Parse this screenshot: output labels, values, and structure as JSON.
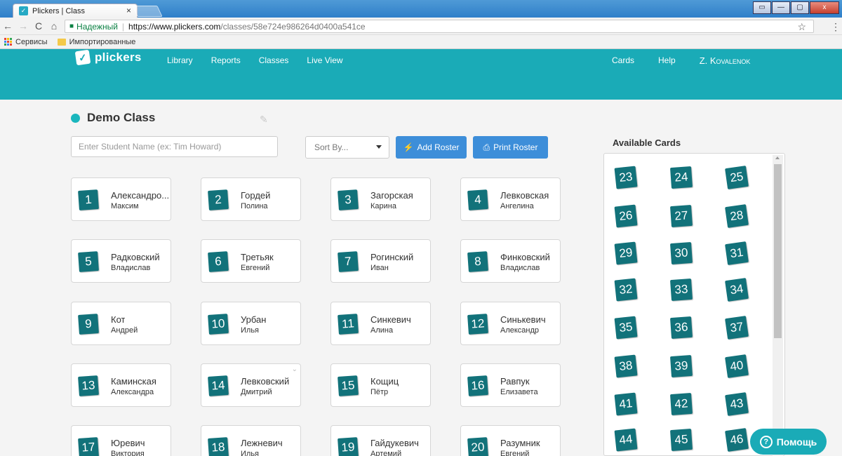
{
  "browser": {
    "tab_title": "Plickers | Class",
    "tab_close": "×",
    "secure_label": "Надежный",
    "url_host": "https://www.plickers.com",
    "url_path": "/classes/58e724e986264d0400a541ce",
    "bookmarks": [
      "Сервисы",
      "Импортированные"
    ],
    "window_controls": [
      "▭",
      "—",
      "▢",
      "x"
    ]
  },
  "app": {
    "logo": "plickers",
    "nav_left": [
      "Library",
      "Reports",
      "Classes",
      "Live View"
    ],
    "nav_right": [
      "Cards",
      "Help"
    ],
    "user": "Z. Kovalenok",
    "accent_color": "#1aabb7"
  },
  "class": {
    "name": "Demo Class",
    "search_placeholder": "Enter Student Name (ex: Tim Howard)",
    "sort_label": "Sort By...",
    "add_roster": "Add Roster",
    "print_roster": "Print Roster"
  },
  "students": [
    {
      "num": "1",
      "last": "Александро...",
      "first": "Максим"
    },
    {
      "num": "2",
      "last": "Гордей",
      "first": "Полина"
    },
    {
      "num": "3",
      "last": "Загорская",
      "first": "Карина"
    },
    {
      "num": "4",
      "last": "Левковская",
      "first": "Ангелина"
    },
    {
      "num": "5",
      "last": "Радковский",
      "first": "Владислав"
    },
    {
      "num": "6",
      "last": "Третьяк",
      "first": "Евгений"
    },
    {
      "num": "7",
      "last": "Рогинский",
      "first": "Иван"
    },
    {
      "num": "8",
      "last": "Финковский",
      "first": "Владислав"
    },
    {
      "num": "9",
      "last": "Кот",
      "first": "Андрей"
    },
    {
      "num": "10",
      "last": "Урбан",
      "first": "Илья"
    },
    {
      "num": "11",
      "last": "Синкевич",
      "first": "Алина"
    },
    {
      "num": "12",
      "last": "Синькевич",
      "first": "Александр"
    },
    {
      "num": "13",
      "last": "Каминская",
      "first": "Александра"
    },
    {
      "num": "14",
      "last": "Левковский",
      "first": "Дмитрий"
    },
    {
      "num": "15",
      "last": "Кощиц",
      "first": "Пётр"
    },
    {
      "num": "16",
      "last": "Равпук",
      "first": "Елизавета"
    },
    {
      "num": "17",
      "last": "Юревич",
      "first": "Виктория"
    },
    {
      "num": "18",
      "last": "Лежневич",
      "first": "Илья"
    },
    {
      "num": "19",
      "last": "Гайдукевич",
      "first": "Артемий"
    },
    {
      "num": "20",
      "last": "Разумник",
      "first": "Евгений"
    }
  ],
  "available": {
    "title": "Available Cards",
    "cards": [
      "23",
      "24",
      "25",
      "26",
      "27",
      "28",
      "29",
      "30",
      "31",
      "32",
      "33",
      "34",
      "35",
      "36",
      "37",
      "38",
      "39",
      "40",
      "41",
      "42",
      "43",
      "44",
      "45",
      "46"
    ]
  },
  "help_button": "Помощь"
}
